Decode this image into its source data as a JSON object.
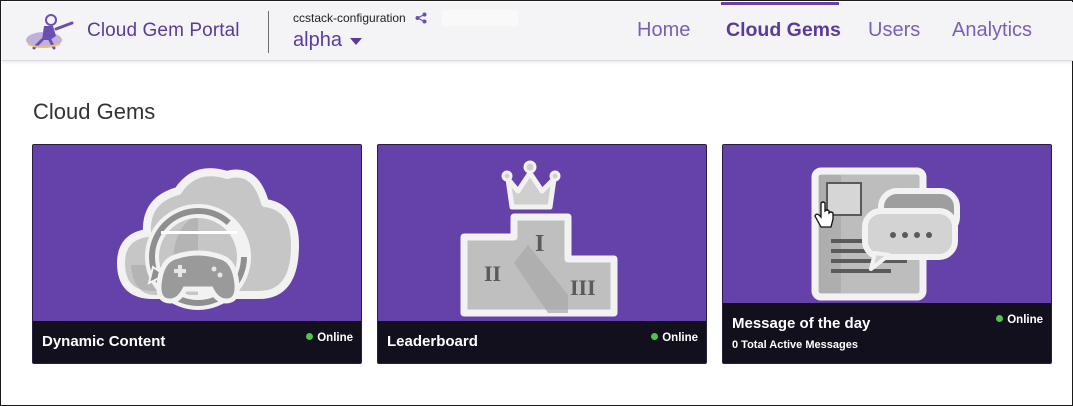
{
  "header": {
    "brand": "Cloud Gem Portal",
    "project_name": "ccstack-configuration",
    "stage": "alpha"
  },
  "nav": {
    "home": "Home",
    "cloud_gems": "Cloud Gems",
    "users": "Users",
    "analytics": "Analytics",
    "active": "Cloud Gems"
  },
  "page": {
    "title": "Cloud Gems"
  },
  "gems": [
    {
      "title": "Dynamic Content",
      "status": "Online",
      "subtitle": "",
      "icon": "cloud-gamepad-icon"
    },
    {
      "title": "Leaderboard",
      "status": "Online",
      "subtitle": "",
      "icon": "podium-crown-icon"
    },
    {
      "title": "Message of the day",
      "status": "Online",
      "subtitle": "0 Total Active Messages",
      "icon": "message-board-icon"
    }
  ],
  "colors": {
    "brand": "#5b3a9e",
    "card_bg": "#6542a9",
    "card_footer": "#12101c",
    "status_online": "#4fc24f"
  }
}
